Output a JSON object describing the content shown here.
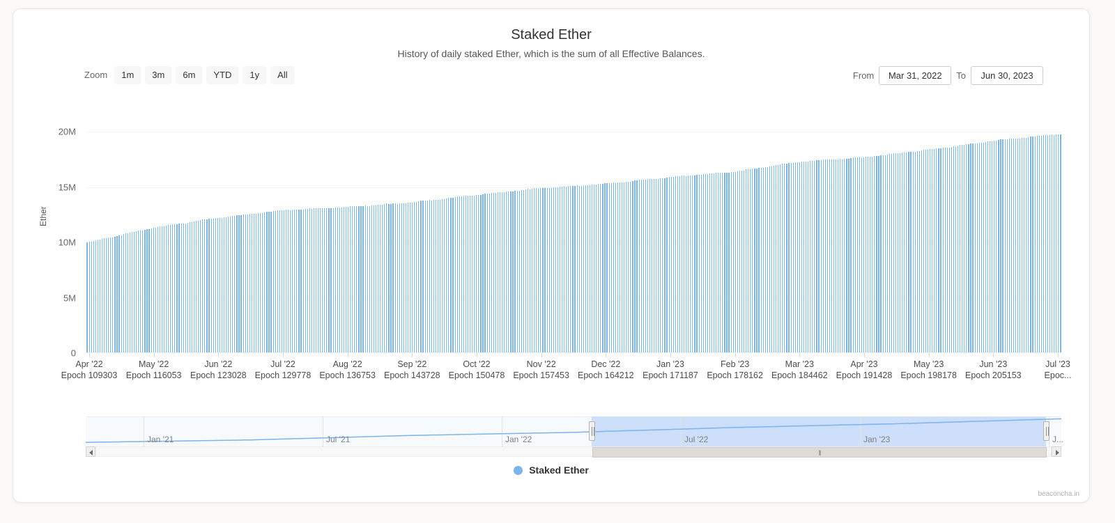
{
  "card": {
    "title": "Staked Ether",
    "subtitle": "History of daily staked Ether, which is the sum of all Effective Balances.",
    "credits": "beaconcha.in"
  },
  "range_selector": {
    "label": "Zoom",
    "buttons": [
      {
        "label": "1m",
        "active": false
      },
      {
        "label": "3m",
        "active": false
      },
      {
        "label": "6m",
        "active": false
      },
      {
        "label": "YTD",
        "active": false
      },
      {
        "label": "1y",
        "active": false
      },
      {
        "label": "All",
        "active": false
      }
    ],
    "from_label": "From",
    "from_value": "Mar 31, 2022",
    "to_label": "To",
    "to_value": "Jun 30, 2023"
  },
  "legend": {
    "series_label": "Staked Ether",
    "color": "#7cb5ec"
  },
  "navigator": {
    "labels": [
      "Jan '21",
      "Jul '21",
      "Jan '22",
      "Jul '22",
      "Jan '23",
      "J..."
    ],
    "selection_from": "Mar 31, 2022",
    "selection_to": "Jun 30, 2023"
  },
  "chart_data": {
    "type": "bar",
    "title": "Staked Ether",
    "subtitle": "History of daily staked Ether, which is the sum of all Effective Balances.",
    "xlabel": "",
    "ylabel": "Ether",
    "ylim": [
      0,
      20000000
    ],
    "ytick_values": [
      0,
      5000000,
      10000000,
      15000000,
      20000000
    ],
    "ytick_labels": [
      "0",
      "5M",
      "10M",
      "15M",
      "20M"
    ],
    "grid": true,
    "legend_position": "bottom",
    "series": [
      {
        "name": "Staked Ether",
        "color": "#7cb5ec",
        "unit": "Ether"
      }
    ],
    "xticks": [
      {
        "month": "Apr '22",
        "epoch": "Epoch 109303"
      },
      {
        "month": "May '22",
        "epoch": "Epoch 116053"
      },
      {
        "month": "Jun '22",
        "epoch": "Epoch 123028"
      },
      {
        "month": "Jul '22",
        "epoch": "Epoch 129778"
      },
      {
        "month": "Aug '22",
        "epoch": "Epoch 136753"
      },
      {
        "month": "Sep '22",
        "epoch": "Epoch 143728"
      },
      {
        "month": "Oct '22",
        "epoch": "Epoch 150478"
      },
      {
        "month": "Nov '22",
        "epoch": "Epoch 157453"
      },
      {
        "month": "Dec '22",
        "epoch": "Epoch 164212"
      },
      {
        "month": "Jan '23",
        "epoch": "Epoch 171187"
      },
      {
        "month": "Feb '23",
        "epoch": "Epoch 178162"
      },
      {
        "month": "Mar '23",
        "epoch": "Epoch 184462"
      },
      {
        "month": "Apr '23",
        "epoch": "Epoch 191428"
      },
      {
        "month": "May '23",
        "epoch": "Epoch 198178"
      },
      {
        "month": "Jun '23",
        "epoch": "Epoch 205153"
      },
      {
        "month": "Jul '23",
        "epoch": "Epoc..."
      }
    ],
    "monthly_points": [
      {
        "x": "Apr '22",
        "y": 10000000
      },
      {
        "x": "May '22",
        "y": 11300000
      },
      {
        "x": "Jun '22",
        "y": 12200000
      },
      {
        "x": "Jul '22",
        "y": 12900000
      },
      {
        "x": "Aug '22",
        "y": 13200000
      },
      {
        "x": "Sep '22",
        "y": 13600000
      },
      {
        "x": "Oct '22",
        "y": 14300000
      },
      {
        "x": "Nov '22",
        "y": 14900000
      },
      {
        "x": "Dec '22",
        "y": 15300000
      },
      {
        "x": "Jan '23",
        "y": 15900000
      },
      {
        "x": "Feb '23",
        "y": 16400000
      },
      {
        "x": "Mar '23",
        "y": 17300000
      },
      {
        "x": "Apr '23",
        "y": 17700000
      },
      {
        "x": "May '23",
        "y": 18400000
      },
      {
        "x": "Jun '23",
        "y": 19200000
      },
      {
        "x": "Jun 30, 2023",
        "y": 19800000
      }
    ],
    "navigator_points": [
      {
        "x": "Dec '20",
        "y": 1000000
      },
      {
        "x": "Jan '21",
        "y": 2900000
      },
      {
        "x": "Jul '21",
        "y": 6500000
      },
      {
        "x": "Jan '22",
        "y": 9000000
      },
      {
        "x": "Jul '22",
        "y": 12900000
      },
      {
        "x": "Jan '23",
        "y": 15900000
      },
      {
        "x": "Jun '23",
        "y": 19800000
      }
    ]
  }
}
